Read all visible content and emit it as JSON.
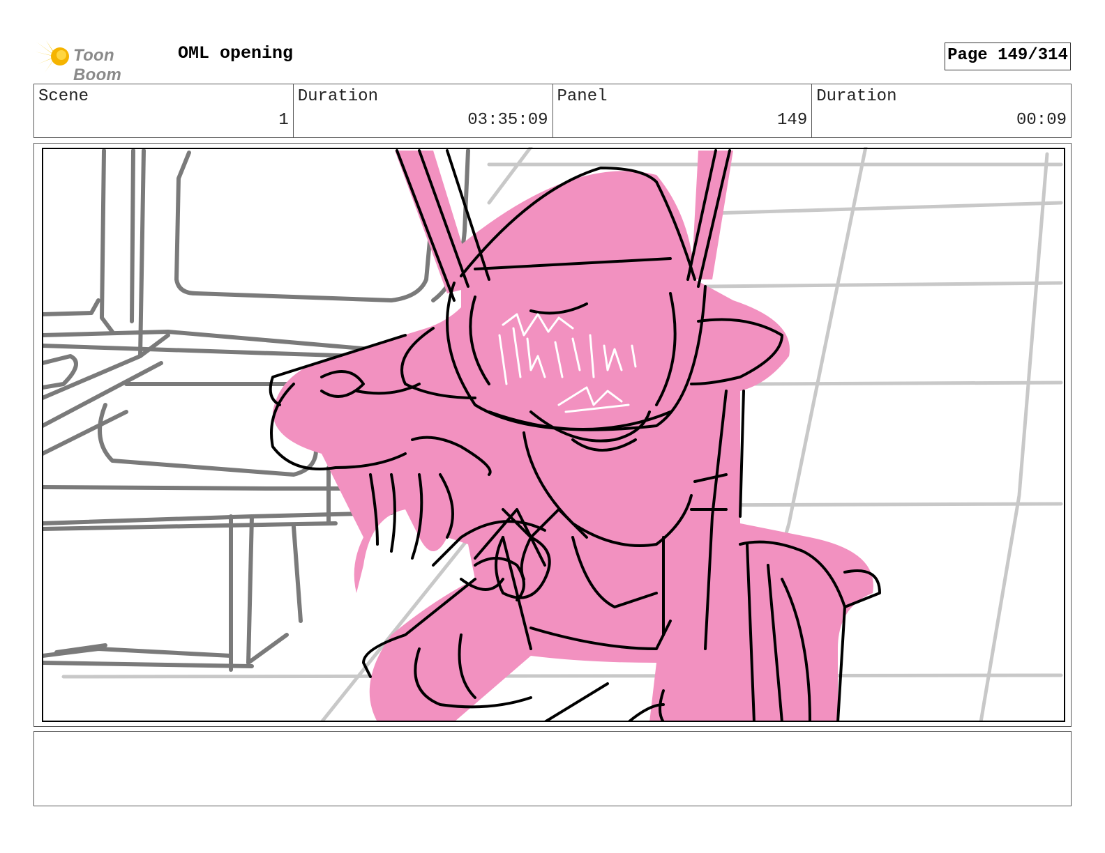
{
  "header": {
    "logo_text": "Toon Boom",
    "project_title": "OML opening",
    "page_label": "Page 149/314"
  },
  "info": {
    "scene_label": "Scene",
    "scene_value": "1",
    "scene_duration_label": "Duration",
    "scene_duration_value": "03:35:09",
    "panel_label": "Panel",
    "panel_value": "149",
    "panel_duration_label": "Duration",
    "panel_duration_value": "00:09"
  },
  "colors": {
    "character_fill": "#f291c0",
    "line_black": "#000000",
    "background_lines": "#7a7a7a",
    "grid_lines": "#c8c8c8",
    "logo_star": "#f5c400"
  },
  "notes": {
    "text": ""
  }
}
